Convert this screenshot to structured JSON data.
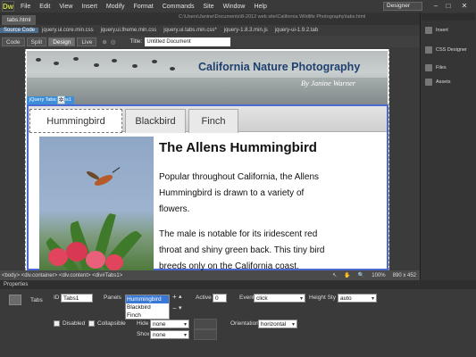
{
  "app": {
    "logo": "Dw",
    "workspace": "Designer"
  },
  "menu": [
    "File",
    "Edit",
    "View",
    "Insert",
    "Modify",
    "Format",
    "Commands",
    "Site",
    "Window",
    "Help"
  ],
  "doc_tabs": [
    {
      "label": "tabs.html"
    }
  ],
  "file_path": "C:\\Users\\Janine\\Documents\\8-2012 web site\\California Wildlife Photography\\tabs.html",
  "related_files": [
    "Source Code",
    "jquery.ui.core.min.css",
    "jquery.ui.theme.min.css",
    "jquery.ui.tabs.min.css*",
    "jquery-1.8.3.min.js",
    "jquery-ui-1.9.2.tab"
  ],
  "view_buttons": [
    "Code",
    "Split",
    "Design",
    "Live"
  ],
  "title_label": "Title:",
  "title_value": "Untitled Document",
  "banner": {
    "title": "California Nature Photography",
    "subtitle": "By Janine Warner"
  },
  "jquery_label": "jQuery Tabs: Tabs1",
  "tabs": [
    "Hummingbird",
    "Blackbird",
    "Finch"
  ],
  "content": {
    "heading": "The Allens Hummingbird",
    "para1_l1": "Popular throughout California, the Allens",
    "para1_l2": "Hummingbird is drawn to a variety of",
    "para1_l3": "flowers.",
    "para2_l1": "The male is notable for its iridescent red",
    "para2_l2": "throat and shiny green back. This tiny bird",
    "para2_l3": "breeds only on the California coast."
  },
  "right_panel": [
    "Insert",
    "CSS Designer",
    "Files",
    "Assets"
  ],
  "status": {
    "tags": "<body> <div.container> <div.content> <div#Tabs1>",
    "size": "890 x 452",
    "zoom": "100%"
  },
  "properties": {
    "header": "Properties",
    "widget": "Tabs",
    "id_label": "ID",
    "id_value": "Tabs1",
    "panels_label": "Panels",
    "panels": [
      "Hummingbird",
      "Blackbird",
      "Finch"
    ],
    "active_label": "Active",
    "active_value": "0",
    "event_label": "Event",
    "event_value": "click",
    "height_label": "Height Style",
    "height_value": "auto",
    "disabled_label": "Disabled",
    "collapsible_label": "Collapsible",
    "hide_label": "Hide",
    "hide_value": "none",
    "show_label": "Show",
    "show_value": "none",
    "orientation_label": "Orientation",
    "orientation_value": "horizontal"
  },
  "colors": {
    "tab_border": "#4b68d3",
    "banner_title": "#20406f",
    "selection": "#3a78d6"
  }
}
